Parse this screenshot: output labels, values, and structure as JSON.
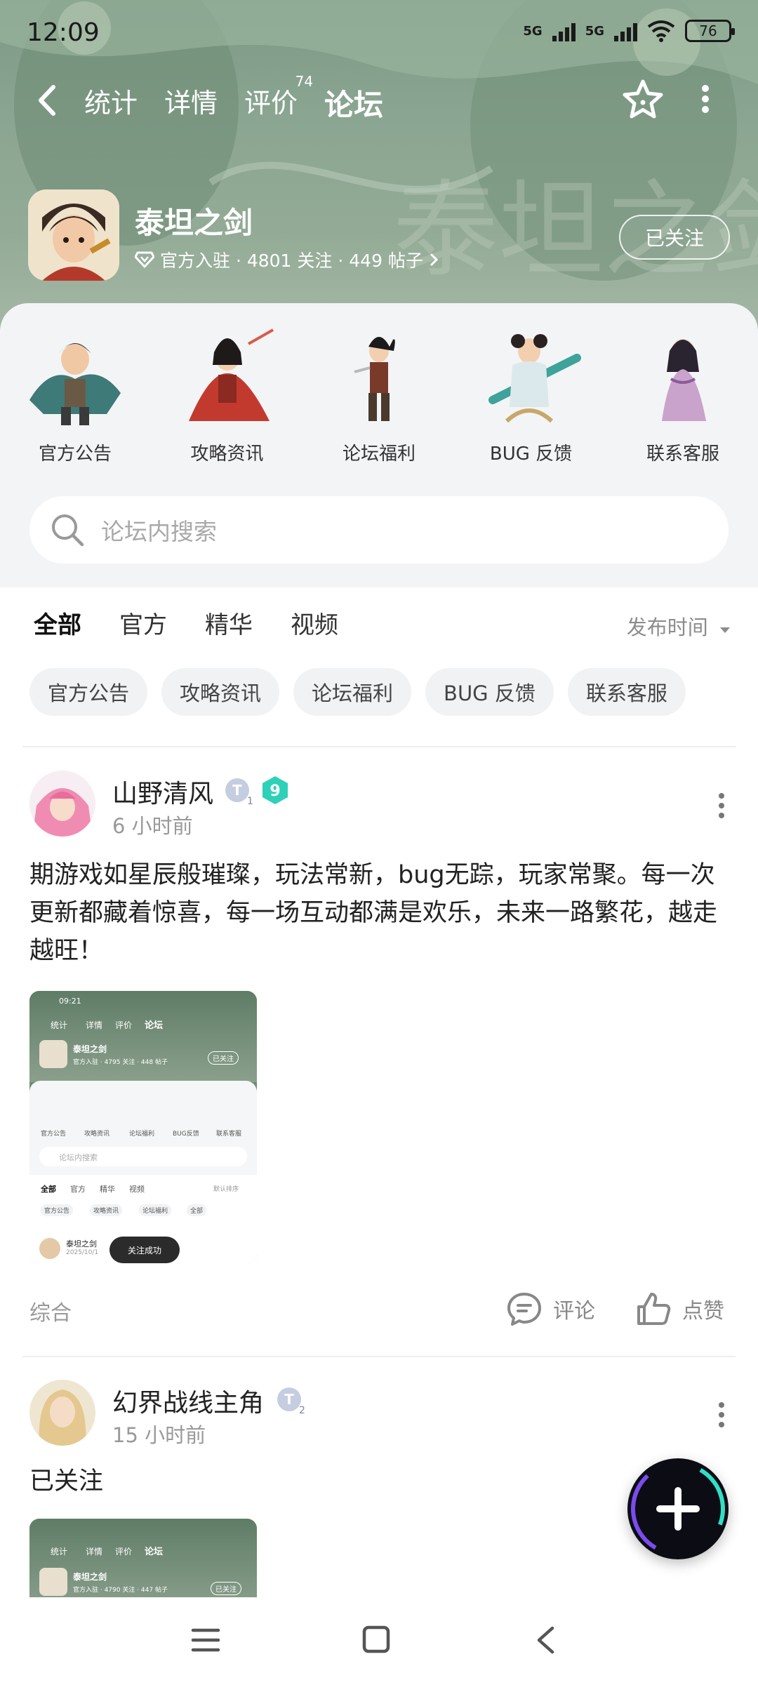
{
  "status": {
    "time": "12:09",
    "net1": "5G",
    "net2": "5G",
    "battery": "76"
  },
  "nav": {
    "tabs": [
      {
        "label": "统计"
      },
      {
        "label": "详情"
      },
      {
        "label": "评价",
        "badge": "74"
      },
      {
        "label": "论坛"
      }
    ],
    "active_tab": "论坛"
  },
  "game": {
    "name": "泰坦之剑",
    "meta": "官方入驻 · 4801 关注 · 449 帖子",
    "follow_label": "已关注"
  },
  "categories": [
    {
      "label": "官方公告"
    },
    {
      "label": "攻略资讯"
    },
    {
      "label": "论坛福利"
    },
    {
      "label": "BUG 反馈"
    },
    {
      "label": "联系客服"
    }
  ],
  "search": {
    "placeholder": "论坛内搜索"
  },
  "filter_tabs": [
    {
      "label": "全部"
    },
    {
      "label": "官方"
    },
    {
      "label": "精华"
    },
    {
      "label": "视频"
    }
  ],
  "sort_label": "发布时间",
  "chips": [
    {
      "label": "官方公告"
    },
    {
      "label": "攻略资讯"
    },
    {
      "label": "论坛福利"
    },
    {
      "label": "BUG 反馈"
    },
    {
      "label": "联系客服"
    }
  ],
  "posts": [
    {
      "author": "山野清风",
      "level_badge": "1",
      "vip_badge": "9",
      "time": "6 小时前",
      "text": "期游戏如星辰般璀璨，玩法常新，bug无踪，玩家常聚。每一次更新都藏着惊喜，每一场互动都满是欢乐，未来一路繁花，越走越旺！",
      "tag": "综合",
      "comment_label": "评论",
      "like_label": "点赞",
      "thumb": {
        "time": "09:21",
        "tabs": [
          "统计",
          "详情",
          "评价",
          "论坛"
        ],
        "name": "泰坦之剑",
        "meta": "官方入驻 · 4795 关注 · 448 帖子",
        "follow": "已关注",
        "cats": [
          "官方公告",
          "攻略资讯",
          "论坛福利",
          "BUG反馈",
          "联系客服"
        ],
        "search": "论坛内搜索",
        "ftabs": [
          "全部",
          "官方",
          "精华",
          "视频"
        ],
        "sort": "默认排序",
        "chips": [
          "官方公告",
          "攻略资讯",
          "论坛福利",
          "全部"
        ],
        "post_name": "泰坦之剑",
        "post_date": "2025/10/1",
        "toast": "关注成功"
      }
    },
    {
      "author": "幻界战线主角",
      "level_badge": "2",
      "time": "15 小时前",
      "text": "已关注",
      "thumb": {
        "tabs": [
          "统计",
          "详情",
          "评价",
          "论坛"
        ],
        "name": "泰坦之剑",
        "meta": "官方入驻 · 4790 关注 · 447 帖子",
        "follow": "已关注"
      }
    }
  ],
  "colors": {
    "accent": "#20c9b0",
    "hero": "#8aa591",
    "panel": "#f3f4f6"
  }
}
